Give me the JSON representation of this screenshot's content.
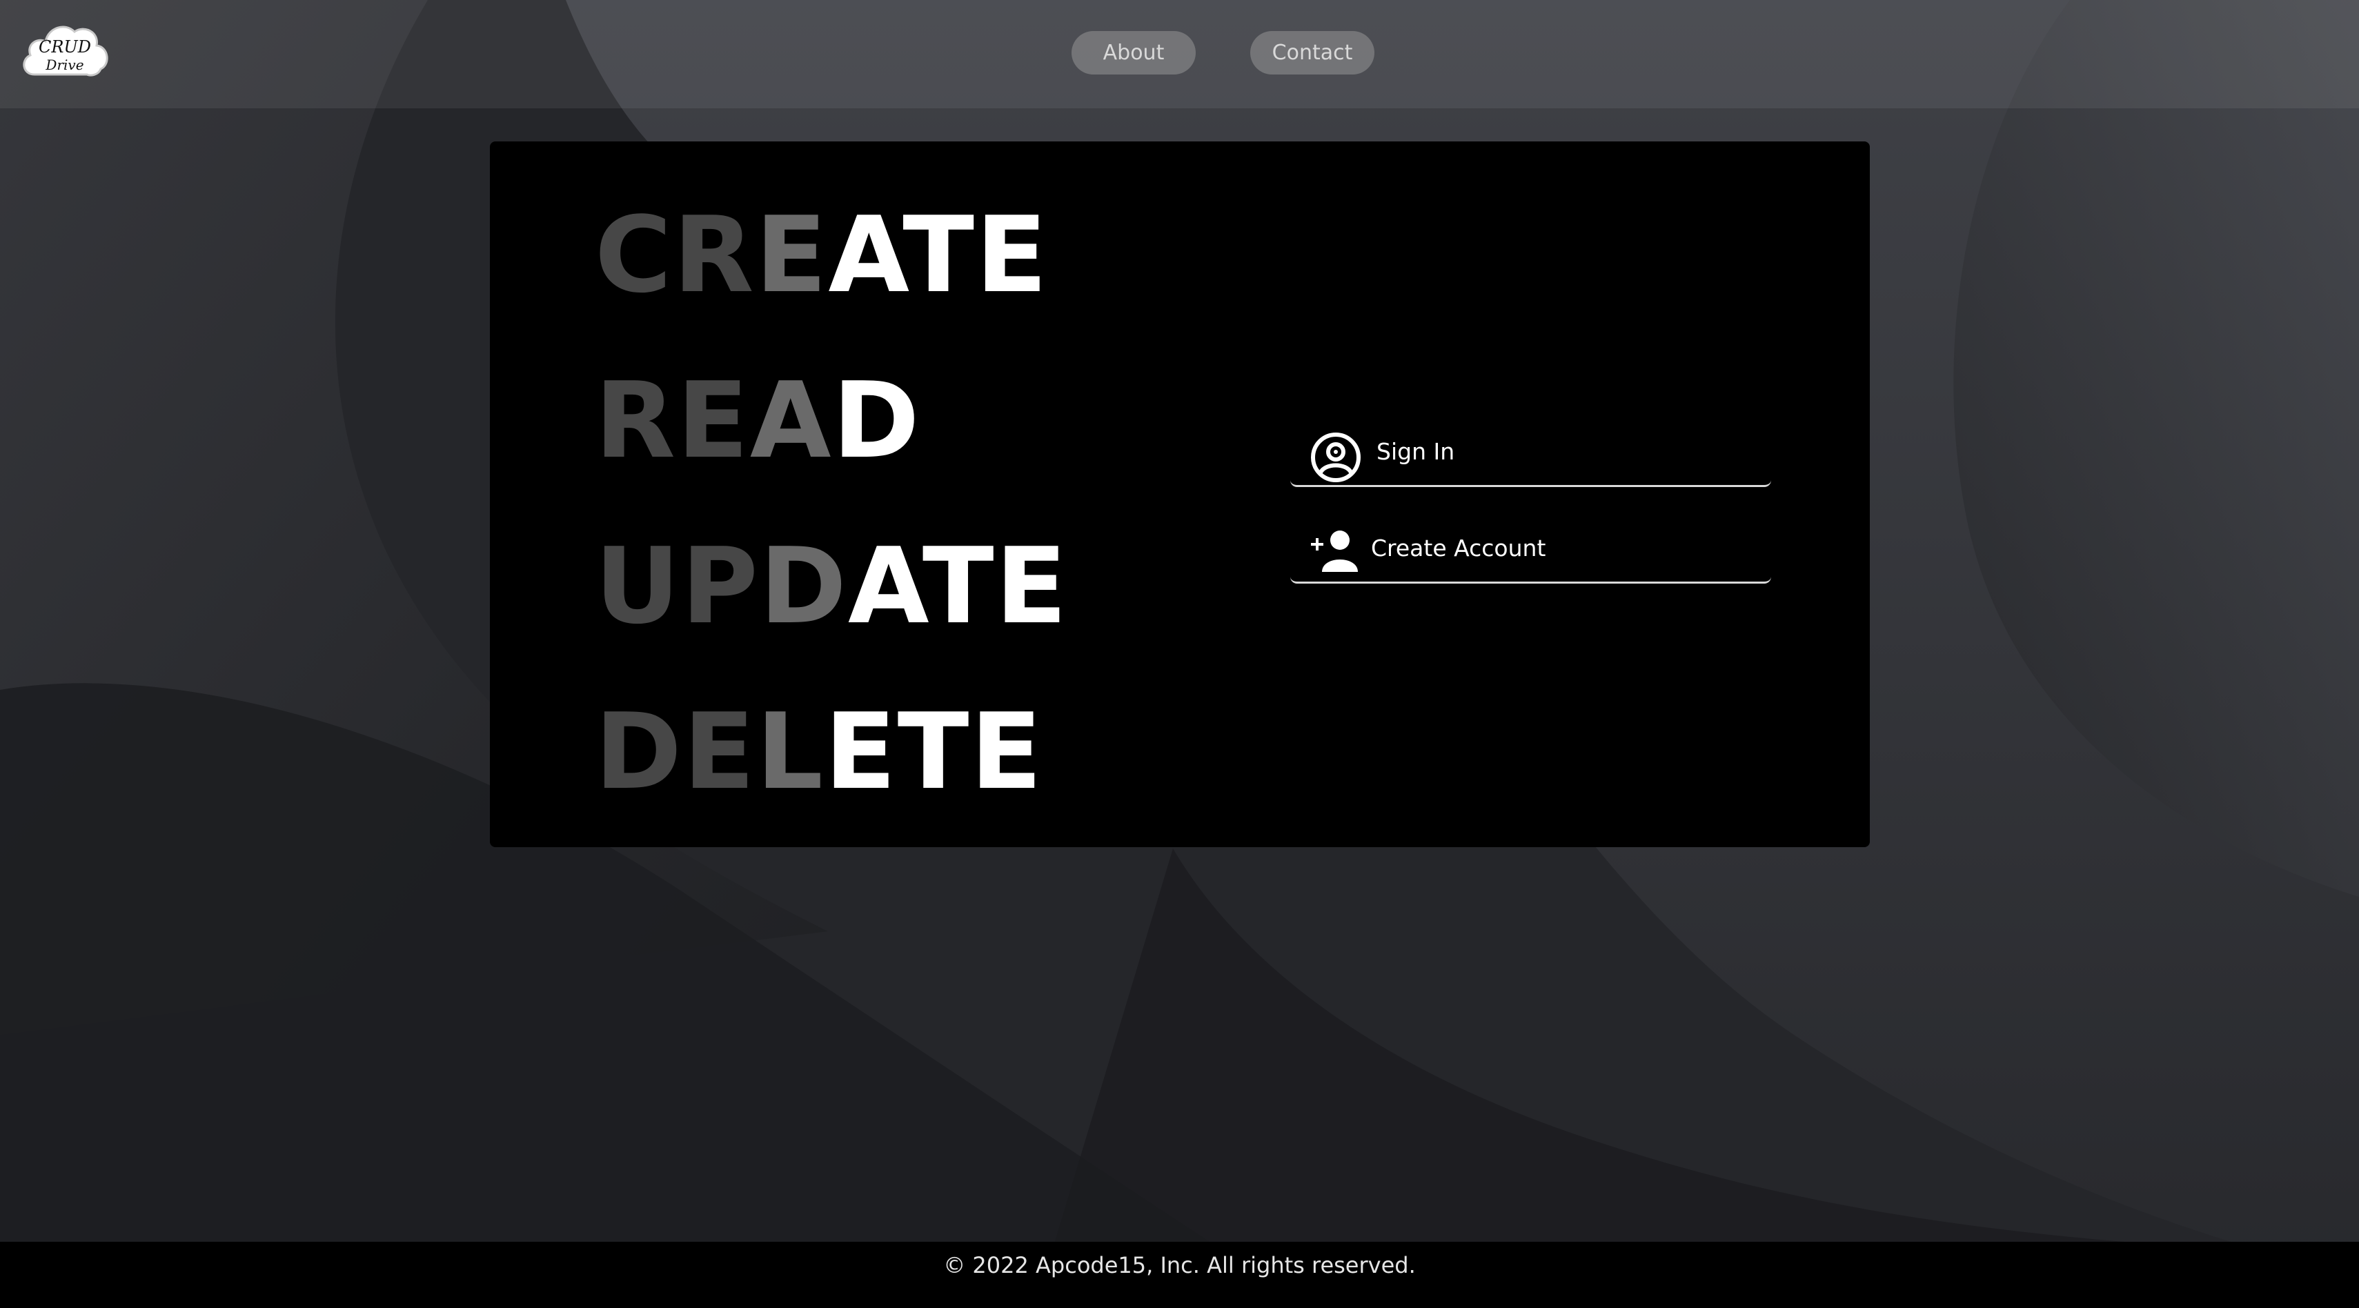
{
  "logo": {
    "line1": "CRUD",
    "line2": "Drive"
  },
  "nav": {
    "about_label": "About",
    "contact_label": "Contact"
  },
  "hero": {
    "words": [
      {
        "dim": "CRE",
        "mid": "A",
        "lit": "ATE",
        "full": "CREATE"
      },
      {
        "dim": "REA",
        "mid": "D",
        "lit": "D",
        "full": "READ"
      },
      {
        "dim": "UPD",
        "mid": "A",
        "lit": "ATE",
        "full": "UPDATE"
      },
      {
        "dim": "DEL",
        "mid": "E",
        "lit": "ETE",
        "full": "DELETE"
      }
    ]
  },
  "auth": {
    "sign_in_label": "Sign In",
    "create_account_label": "Create Account",
    "sign_in_icon": "user-circle-icon",
    "create_account_icon": "add-user-icon"
  },
  "footer": {
    "copyright": "© 2022 Apcode15, Inc. All rights reserved."
  },
  "colors": {
    "background": "#232427",
    "card": "#000000",
    "nav_button": "#8c8c8c",
    "text_lit": "#ffffff",
    "text_dim": "#474747"
  }
}
